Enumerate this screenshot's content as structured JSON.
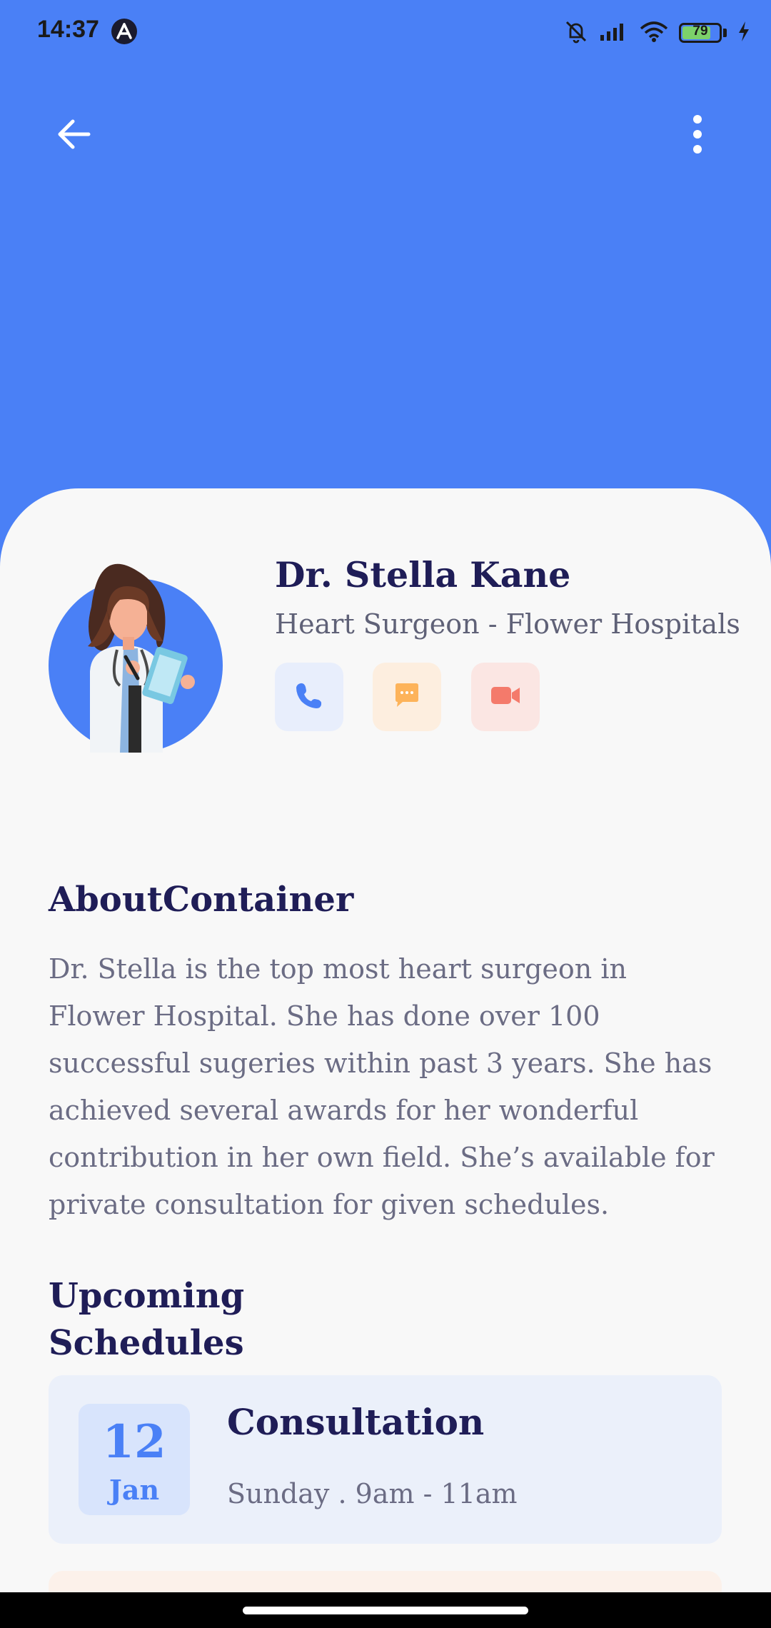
{
  "status_bar": {
    "time": "14:37",
    "battery_level": "79",
    "battery_percent": 79
  },
  "header": {
    "back_icon": "arrow-left-icon",
    "more_icon": "more-vertical-icon"
  },
  "doctor": {
    "name": "Dr. Stella Kane",
    "subtitle": "Heart Surgeon - Flower Hospitals",
    "actions": [
      {
        "icon": "phone-icon",
        "color": "#4A80F6"
      },
      {
        "icon": "chat-icon",
        "color": "#FDB35A"
      },
      {
        "icon": "video-camera-icon",
        "color": "#F47A6B"
      }
    ]
  },
  "about": {
    "title": "AboutContainer",
    "text": "Dr. Stella is the top most heart surgeon in Flower Hospital. She has done over 100 successful sugeries within past 3 years. She has achieved several awards for her wonderful contribution in her own field. She’s available for private consultation for given schedules."
  },
  "schedules": {
    "title": "Upcoming Schedules",
    "items": [
      {
        "day": "12",
        "month": "Jan",
        "title": "Consultation",
        "time": "Sunday . 9am - 11am"
      }
    ]
  },
  "colors": {
    "primary": "#4A80F6",
    "heading": "#1F1D57",
    "body_text": "#6B6C84",
    "sheet_background": "#F8F8F8"
  }
}
